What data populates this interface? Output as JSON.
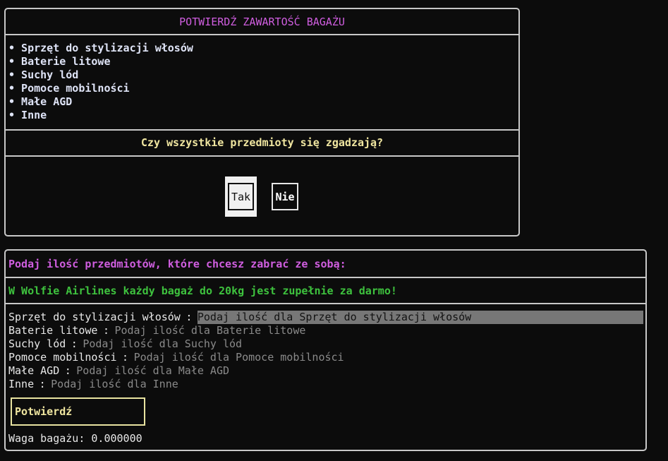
{
  "confirm_panel": {
    "title": "POTWIERDŹ ZAWARTOŚĆ BAGAŻU",
    "items": [
      "• Sprzęt do stylizacji włosów",
      "• Baterie litowe",
      "• Suchy lód",
      "• Pomoce mobilności",
      "• Małe AGD",
      "• Inne"
    ],
    "question": "Czy wszystkie przedmioty się zgadzają?",
    "yes_label": "Tak",
    "no_label": "Nie"
  },
  "quantity_panel": {
    "prompt": "Podaj ilość przedmiotów, które chcesz zabrać ze sobą:",
    "promo": "W Wolfie Airlines każdy bagaż do 20kg jest zupełnie za darmo!",
    "separator": ":",
    "rows": [
      {
        "label": "Sprzęt do stylizacji włosów",
        "placeholder": "Podaj ilość dla Sprzęt do stylizacji włosów"
      },
      {
        "label": "Baterie litowe",
        "placeholder": "Podaj ilość dla Baterie litowe"
      },
      {
        "label": "Suchy lód",
        "placeholder": "Podaj ilość dla Suchy lód"
      },
      {
        "label": "Pomoce mobilności",
        "placeholder": "Podaj ilość dla Pomoce mobilności"
      },
      {
        "label": "Małe AGD",
        "placeholder": "Podaj ilość dla Małe AGD"
      },
      {
        "label": "Inne",
        "placeholder": "Podaj ilość dla Inne"
      }
    ],
    "confirm_label": "Potwierdź",
    "weight_text": "Waga bagażu: 0.000000"
  },
  "colors": {
    "accent_magenta": "#d05ee0",
    "accent_yellow": "#f0e6a0",
    "promo_green": "#3ec23e",
    "focus_bg": "#777777"
  }
}
